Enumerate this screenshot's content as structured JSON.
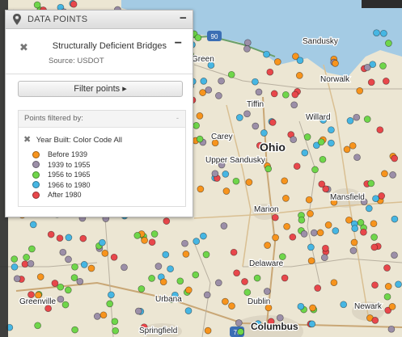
{
  "panel": {
    "title": "DATA POINTS",
    "collapse_symbol": "−",
    "layer": {
      "close_symbol": "✖",
      "title": "Structurally Deficient Bridges",
      "collapse_symbol": "−",
      "source": "Source: USDOT"
    },
    "filter_button": "Filter points ▸",
    "filtered_by_label": "Points filtered by:",
    "filtered_by_dash": "-",
    "filter_close_symbol": "✖",
    "filter_name": "Year Built: Color Code All",
    "legend": [
      {
        "label": "Before 1939",
        "color": "#f7941d"
      },
      {
        "label": "1939 to 1955",
        "color": "#9c8fa8"
      },
      {
        "label": "1956 to 1965",
        "color": "#6fd64a"
      },
      {
        "label": "1966 to 1980",
        "color": "#46b6e3"
      },
      {
        "label": "After 1980",
        "color": "#e8474b"
      }
    ]
  },
  "map": {
    "labels": {
      "sandusky": "Sandusky",
      "norwalk": "Norwalk",
      "tiffin": "Tiffin",
      "willard": "Willard",
      "carey": "Carey",
      "ohio": "Ohio",
      "upper_sandusky": "Upper Sandusky",
      "mansfield": "Mansfield",
      "marion": "Marion",
      "delaware": "Delaware",
      "greenville": "Greenville",
      "urbana": "Urbana",
      "dublin": "Dublin",
      "springfield": "Springfield",
      "columbus": "Columbus",
      "newark": "Newark",
      "green": "Green"
    },
    "shields": {
      "i90": "90",
      "i70": "70"
    },
    "lake_color": "#a4cbe4",
    "land_color": "#ece6d3"
  }
}
